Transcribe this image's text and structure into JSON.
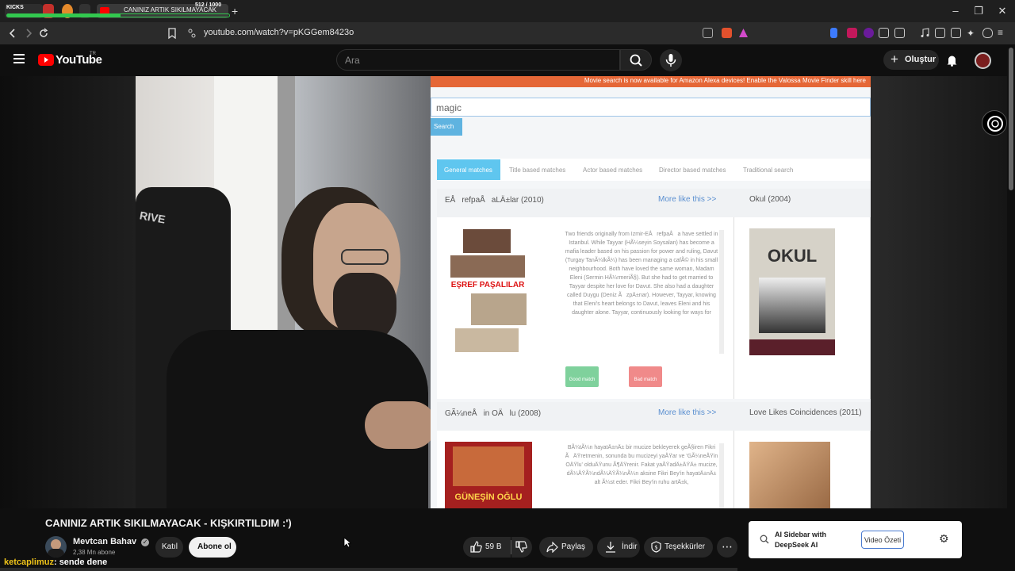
{
  "browser": {
    "kicks_label": "KICKS",
    "counter": "512 / 1000",
    "active_tab_title": "CANINIZ ARTIK SIKILMAYACAK",
    "new_tab_icon": "plus-icon",
    "url": "youtube.com/watch?v=pKGGem8423o"
  },
  "youtube": {
    "logo_text": "YouTube",
    "region": "TR",
    "search_placeholder": "Ara",
    "create_label": "Oluştur"
  },
  "site": {
    "banner": "Movie search is now available for Amazon Alexa devices! Enable the Valossa Movie Finder skill here",
    "search_value": "magic",
    "search_button": "Search",
    "tabs": [
      "General matches",
      "Title based matches",
      "Actor based matches",
      "Director based matches",
      "Traditional search"
    ],
    "results": [
      {
        "title": "EÅrefpaÅaLÄ±lar (2010)",
        "more": "More like this >>",
        "plot": "Two friends originally from Izmir-EÅrefpaÅa have settled in Istanbul. While Tayyar (HÃ¼seyin Soysalan) has become a mafia leader based on his passion for power and ruling, Davut (Turgay TanÃ¼lkÃ¼) has been managing a cafÃ© in his small neighbourhood. Both have loved the same woman, Madam Eleni (Sermin HÃ¼rmeriÃ§). But she had to get married to Tayyar despite her love for Davut. She also had a daughter called Duygu (Deniz ÃzpÄ±nar). However, Tayyar, knowing that Eleni's heart belongs to Davut, leaves Eleni and his daughter alone. Tayyar, continuously looking for ways for",
        "poster_text": "EŞREF PAŞALILAR",
        "good": "Good match",
        "bad": "Bad match"
      },
      {
        "title": "GÃ¼neÅin OÄlu (2008)",
        "more": "More like this >>",
        "plot": "BÃ¼tÃ¼n hayatÄ±nÄ± bir mucize bekleyerek geÃ§iren Fikri ÃÄŸretmenin, sonunda bu mucizeyi yaÅŸar ve 'GÃ¼neÅŸin OÄŸlu' olduÄŸunu Ã¶ÄŸrenir. Fakat yaÅŸadÄ±ÄŸÄ± mucize, dÃ¼ÅŸÃ¼ndÃ¼ÄŸÃ¼nÃ¼n aksine Fikri Bey'in hayatÄ±nÄ± alt Ã¼st eder. Fikri Bey'in ruhu artÄ±k,",
        "poster_text": "GÜNEŞİN OĞLU"
      }
    ],
    "side_results": [
      {
        "title": "Okul (2004)",
        "poster_text": "OKUL"
      },
      {
        "title": "Love Likes Coincidences (2011)"
      }
    ]
  },
  "video": {
    "title": "CANINIZ ARTIK SIKILMAYACAK - KIŞKIRTILDIM :')",
    "channel": "Mevtcan Bahav",
    "subscribers": "2,38 Mn abone",
    "join_label": "Katıl",
    "subscribe_label": "Abone ol",
    "likes": "59 B",
    "share_label": "Paylaş",
    "download_label": "İndir",
    "thanks_label": "Teşekkürler"
  },
  "ai_sidebar": {
    "title_line1": "AI Sidebar with",
    "title_line2": "DeepSeek AI",
    "summary_button": "Video Özeti"
  },
  "chat": {
    "user": "ketcaplimuz",
    "message": ": sende dene"
  }
}
